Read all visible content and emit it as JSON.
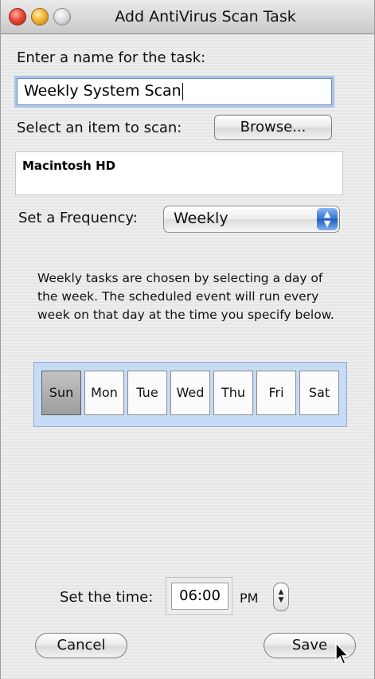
{
  "window": {
    "title": "Add AntiVirus Scan Task"
  },
  "task_name": {
    "label": "Enter a name for the task:",
    "value": "Weekly System Scan"
  },
  "scan_item": {
    "label": "Select an item to scan:",
    "browse_label": "Browse...",
    "selected_items": [
      "Macintosh HD"
    ]
  },
  "frequency": {
    "label": "Set a Frequency:",
    "selected": "Weekly"
  },
  "description": "Weekly tasks are chosen by selecting a day of the week.  The scheduled event will run every week on that day at the time you specify below.",
  "days": [
    {
      "label": "Sun",
      "selected": true
    },
    {
      "label": "Mon",
      "selected": false
    },
    {
      "label": "Tue",
      "selected": false
    },
    {
      "label": "Wed",
      "selected": false
    },
    {
      "label": "Thu",
      "selected": false
    },
    {
      "label": "Fri",
      "selected": false
    },
    {
      "label": "Sat",
      "selected": false
    }
  ],
  "time": {
    "label": "Set the time:",
    "value": "06:00",
    "ampm": "PM"
  },
  "buttons": {
    "cancel": "Cancel",
    "save": "Save"
  },
  "icons": {
    "close": "close-icon",
    "minimize": "minimize-icon",
    "zoom": "zoom-icon",
    "popup_arrows": "up-down-arrows-icon",
    "stepper": "stepper-icon",
    "cursor": "mouse-pointer-icon"
  }
}
